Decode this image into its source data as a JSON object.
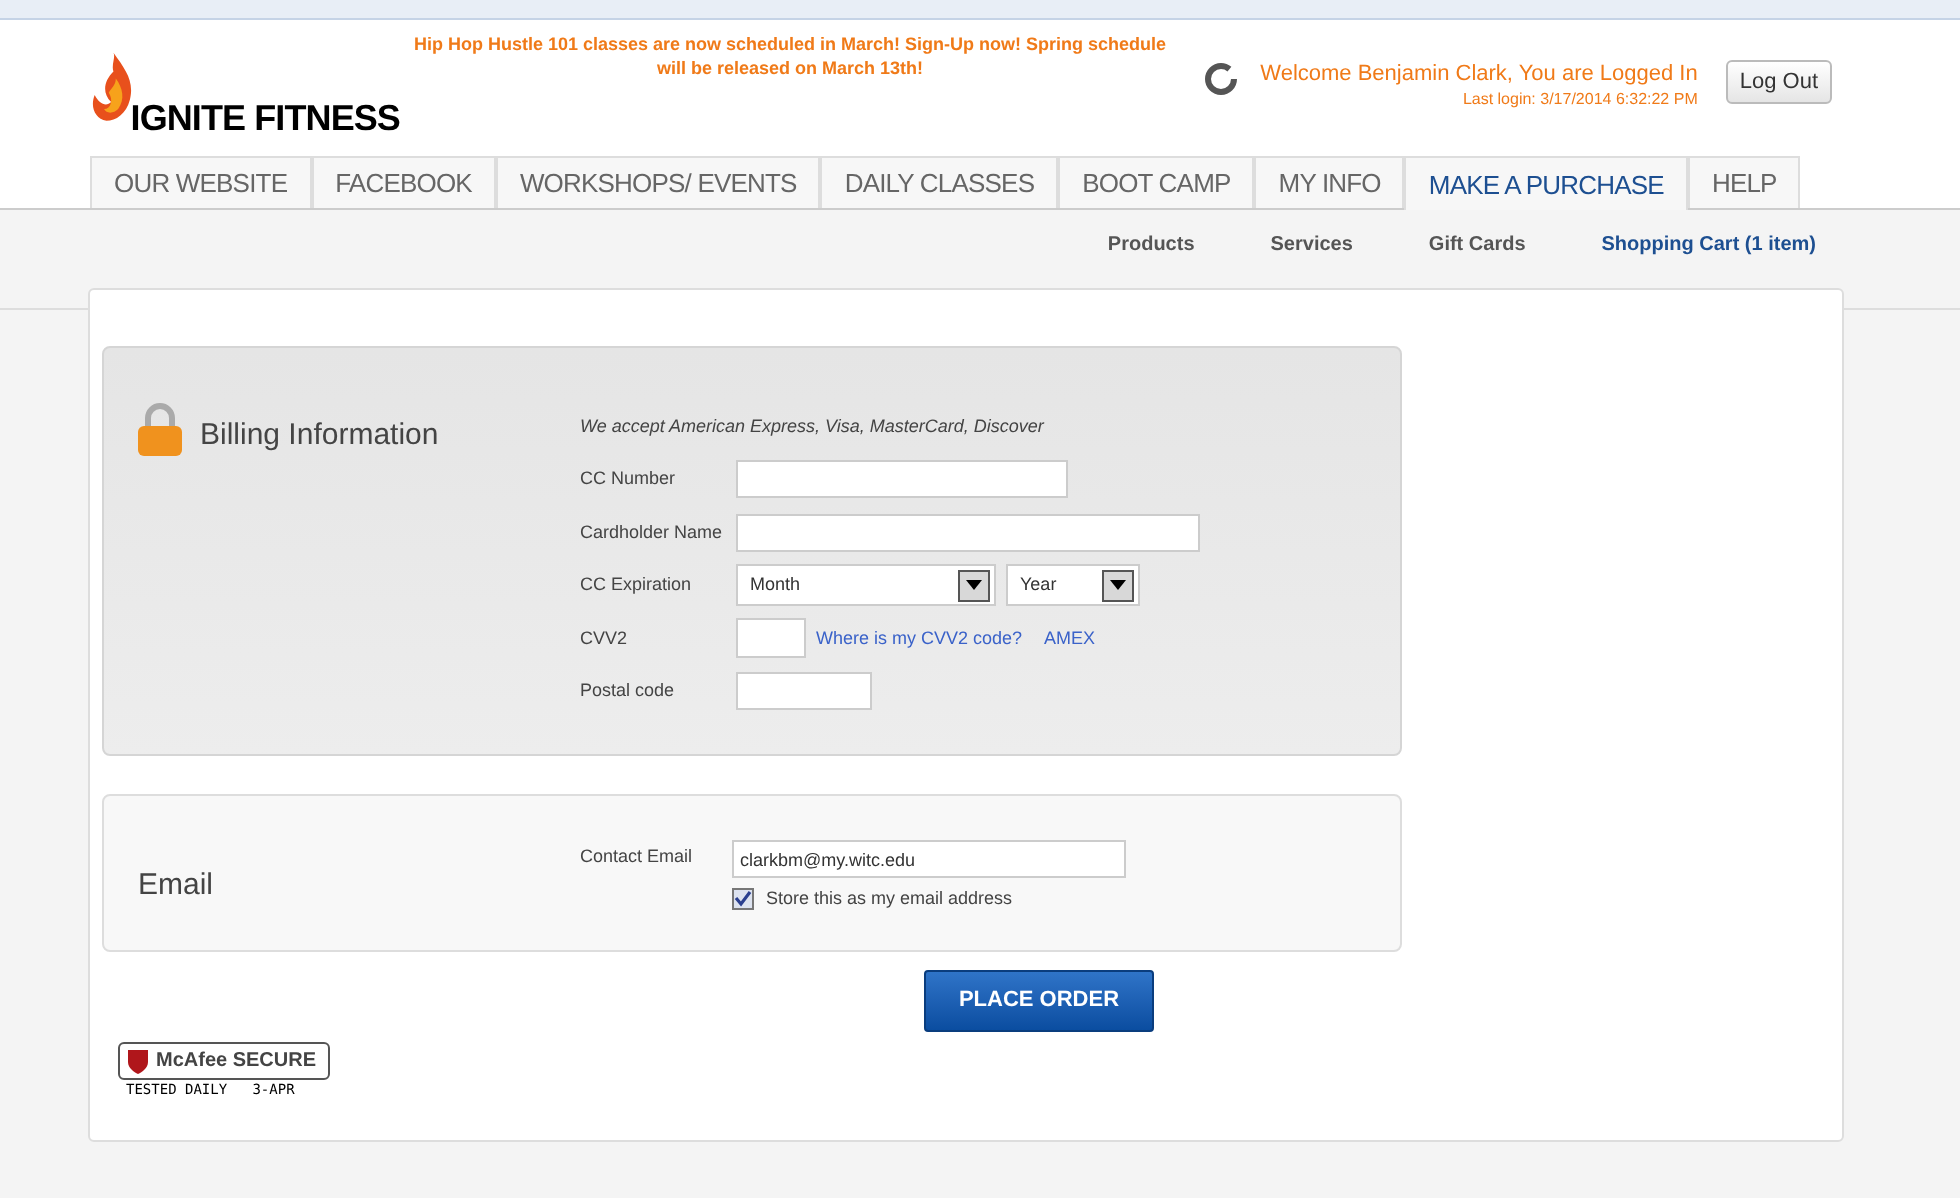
{
  "header": {
    "logo": "IGNITE FITNESS",
    "announcement": "Hip Hop Hustle 101 classes are now scheduled in March! Sign-Up now! Spring schedule will be released on March 13th!",
    "welcome": "Welcome Benjamin Clark, You are Logged In",
    "last_login": "Last login: 3/17/2014 6:32:22 PM",
    "logout": "Log Out"
  },
  "tabs": [
    {
      "label": "OUR WEBSITE",
      "selected": false
    },
    {
      "label": "FACEBOOK",
      "selected": false
    },
    {
      "label": "WORKSHOPS/ EVENTS",
      "selected": false
    },
    {
      "label": "DAILY CLASSES",
      "selected": false
    },
    {
      "label": "BOOT CAMP",
      "selected": false
    },
    {
      "label": "MY INFO",
      "selected": false
    },
    {
      "label": "MAKE A PURCHASE",
      "selected": true
    },
    {
      "label": "HELP",
      "selected": false
    }
  ],
  "subnav": [
    {
      "label": "Products",
      "selected": false
    },
    {
      "label": "Services",
      "selected": false
    },
    {
      "label": "Gift Cards",
      "selected": false
    },
    {
      "label": "Shopping Cart (1 item)",
      "selected": true
    }
  ],
  "billing": {
    "title": "Billing Information",
    "accepted": "We accept American Express, Visa, MasterCard, Discover",
    "fields": [
      {
        "kind": "text",
        "label": "CC Number"
      },
      {
        "kind": "text",
        "label": "Cardholder Name"
      },
      {
        "kind": "selects",
        "label": "CC Expiration",
        "options": [
          "Month",
          "Year"
        ]
      },
      {
        "kind": "cvv",
        "label": "CVV2",
        "links": [
          "Where is my CVV2 code?",
          "AMEX"
        ]
      },
      {
        "kind": "text",
        "label": "Postal code"
      }
    ]
  },
  "email": {
    "title": "Email",
    "label": "Contact Email",
    "value": "clarkbm@my.witc.edu",
    "store_label": "Store this as my email address",
    "store_checked": true
  },
  "place_order": "PLACE ORDER",
  "badge": {
    "title": "McAfee SECURE",
    "subtitle": "TESTED DAILY   3-APR"
  }
}
